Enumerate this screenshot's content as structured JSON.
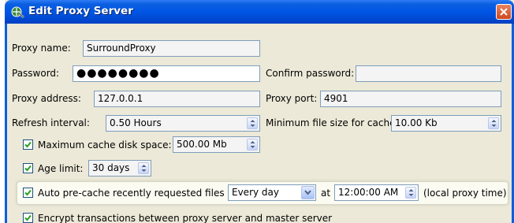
{
  "window": {
    "title": "Edit Proxy Server",
    "icon": "proxy-server-icon",
    "accent": "#0055e5",
    "close_color": "#d0461d"
  },
  "form": {
    "proxy_name": {
      "label": "Proxy name:",
      "value": "SurroundProxy"
    },
    "password": {
      "label": "Password:",
      "value": "●●●●●●●●"
    },
    "confirm_password": {
      "label": "Confirm password:",
      "value": ""
    },
    "proxy_address": {
      "label": "Proxy address:",
      "value": "127.0.0.1"
    },
    "proxy_port": {
      "label": "Proxy port:",
      "value": "4901"
    },
    "refresh_interval": {
      "label": "Refresh interval:",
      "value": "0.50 Hours"
    },
    "min_file_size": {
      "label": "Minimum file size for cache:",
      "value": "10.00 Kb"
    },
    "max_cache": {
      "label": "Maximum cache disk space:",
      "checked": true,
      "value": "500.00 Mb"
    },
    "age_limit": {
      "label": "Age limit:",
      "checked": true,
      "value": "30 days"
    },
    "auto_precache": {
      "label": "Auto pre-cache recently requested files",
      "checked": true,
      "frequency": "Every day",
      "at_label": "at",
      "time": "12:00:00 AM",
      "suffix": "(local proxy time)"
    },
    "encrypt": {
      "label": "Encrypt transactions between proxy server and master server",
      "checked": true
    }
  }
}
